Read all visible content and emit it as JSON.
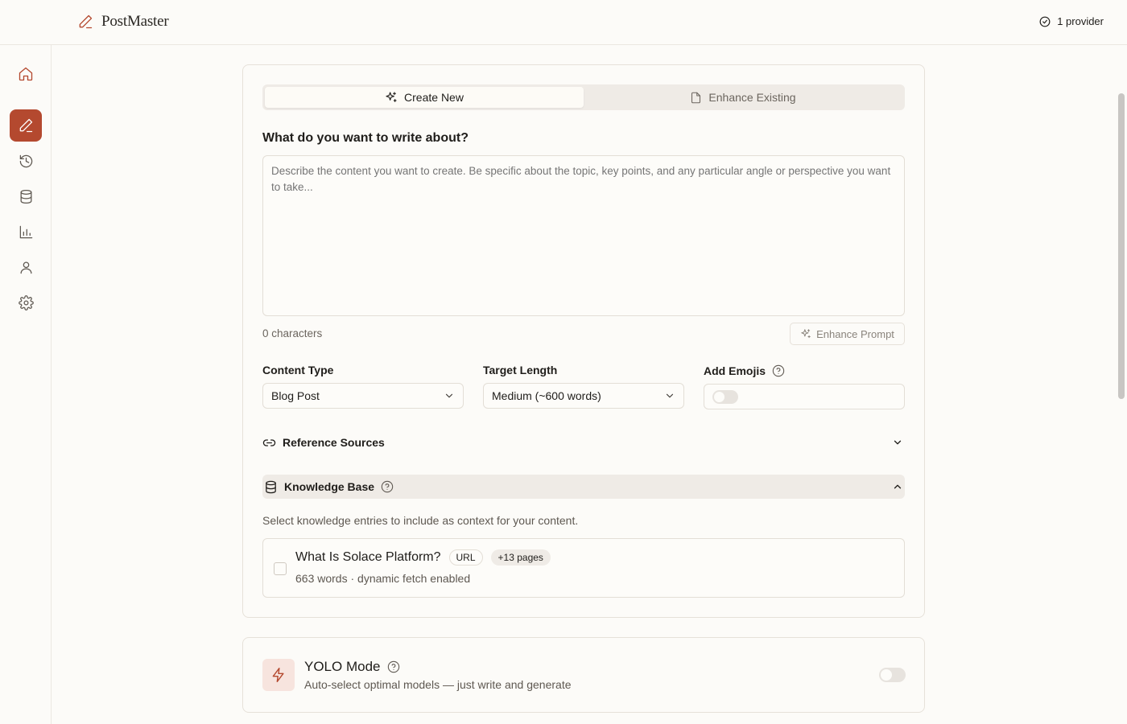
{
  "app": {
    "name": "PostMaster"
  },
  "header": {
    "provider_status": "1 provider"
  },
  "sidebar": {
    "items": [
      {
        "name": "home",
        "icon": "home-icon",
        "active": false
      },
      {
        "name": "create",
        "icon": "pen-icon",
        "active": true
      },
      {
        "name": "history",
        "icon": "history-icon",
        "active": false
      },
      {
        "name": "knowledge",
        "icon": "database-icon",
        "active": false
      },
      {
        "name": "analytics",
        "icon": "chart-icon",
        "active": false
      },
      {
        "name": "profile",
        "icon": "user-icon",
        "active": false
      },
      {
        "name": "settings",
        "icon": "gear-icon",
        "active": false
      }
    ]
  },
  "tabs": [
    {
      "label": "Create New",
      "icon": "sparkles-icon",
      "active": true
    },
    {
      "label": "Enhance Existing",
      "icon": "document-icon",
      "active": false
    }
  ],
  "prompt": {
    "label": "What do you want to write about?",
    "placeholder": "Describe the content you want to create. Be specific about the topic, key points, and any particular angle or perspective you want to take...",
    "value": "",
    "char_count": "0 characters",
    "enhance_label": "Enhance Prompt"
  },
  "options": {
    "content_type": {
      "label": "Content Type",
      "value": "Blog Post"
    },
    "target_length": {
      "label": "Target Length",
      "value": "Medium (~600 words)"
    },
    "add_emojis": {
      "label": "Add Emojis",
      "enabled": false
    }
  },
  "reference_sources": {
    "title": "Reference Sources",
    "expanded": false
  },
  "knowledge_base": {
    "title": "Knowledge Base",
    "expanded": true,
    "description": "Select knowledge entries to include as context for your content.",
    "entries": [
      {
        "title": "What Is Solace Platform?",
        "type_badge": "URL",
        "pages_badge": "+13 pages",
        "meta": "663 words · dynamic fetch enabled",
        "checked": false
      }
    ]
  },
  "yolo": {
    "title": "YOLO Mode",
    "description": "Auto-select optimal models — just write and generate",
    "enabled": false
  },
  "colors": {
    "accent": "#b4492f",
    "background": "#fcfbf8",
    "muted_surface": "#efebe6",
    "yolo_icon_bg": "#f7e4de"
  }
}
